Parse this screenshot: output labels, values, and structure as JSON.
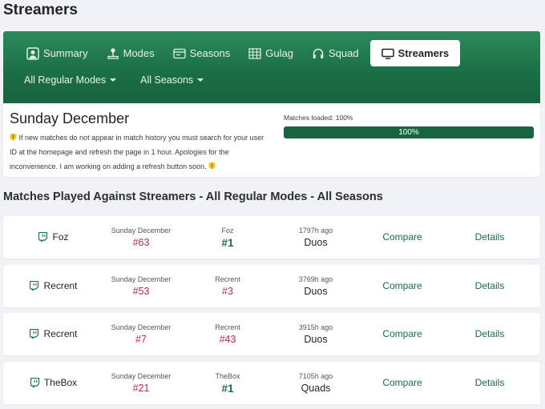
{
  "page_title": "Streamers",
  "tabs": [
    {
      "label": "Summary",
      "icon": "user-icon"
    },
    {
      "label": "Modes",
      "icon": "joystick-icon"
    },
    {
      "label": "Seasons",
      "icon": "calendar-card-icon"
    },
    {
      "label": "Gulag",
      "icon": "fence-icon"
    },
    {
      "label": "Squad",
      "icon": "headset-icon"
    },
    {
      "label": "Streamers",
      "icon": "monitor-icon",
      "active": true
    }
  ],
  "filters": {
    "mode": "All Regular Modes",
    "season": "All Seasons"
  },
  "info": {
    "title": "Sunday December",
    "notice": "If new matches do not appear in match history you must search for your user ID at the homepage and refresh the page in 1 hour. Apologies for the inconvenience. I am working on adding a refresh button soon.",
    "progress_label": "Matches loaded: 100%",
    "progress_text": "100%",
    "progress_value": 1.0
  },
  "section_title": "Matches Played Against Streamers - All Regular Modes - All Seasons",
  "matches": [
    {
      "streamer": "Foz",
      "date": "Sunday December",
      "my_rank": "#63",
      "streamer_label": "Foz",
      "streamer_rank": "#1",
      "ago": "1797h ago",
      "mode": "Duos",
      "compare": "Compare",
      "details": "Details"
    },
    {
      "streamer": "Recrent",
      "date": "Sunday December",
      "my_rank": "#53",
      "streamer_label": "Recrent",
      "streamer_rank": "#3",
      "ago": "3769h ago",
      "mode": "Duos",
      "compare": "Compare",
      "details": "Details"
    },
    {
      "streamer": "Recrent",
      "date": "Sunday December",
      "my_rank": "#7",
      "streamer_label": "Recrent",
      "streamer_rank": "#43",
      "ago": "3915h ago",
      "mode": "Duos",
      "compare": "Compare",
      "details": "Details"
    },
    {
      "streamer": "TheBox",
      "date": "Sunday December",
      "my_rank": "#21",
      "streamer_label": "TheBox",
      "streamer_rank": "#1",
      "ago": "7105h ago",
      "mode": "Quads",
      "compare": "Compare",
      "details": "Details"
    }
  ],
  "colors": {
    "brand": "#1b6e45",
    "loss_rank": "#b72d3a",
    "win_rank": "#1b6e45"
  }
}
